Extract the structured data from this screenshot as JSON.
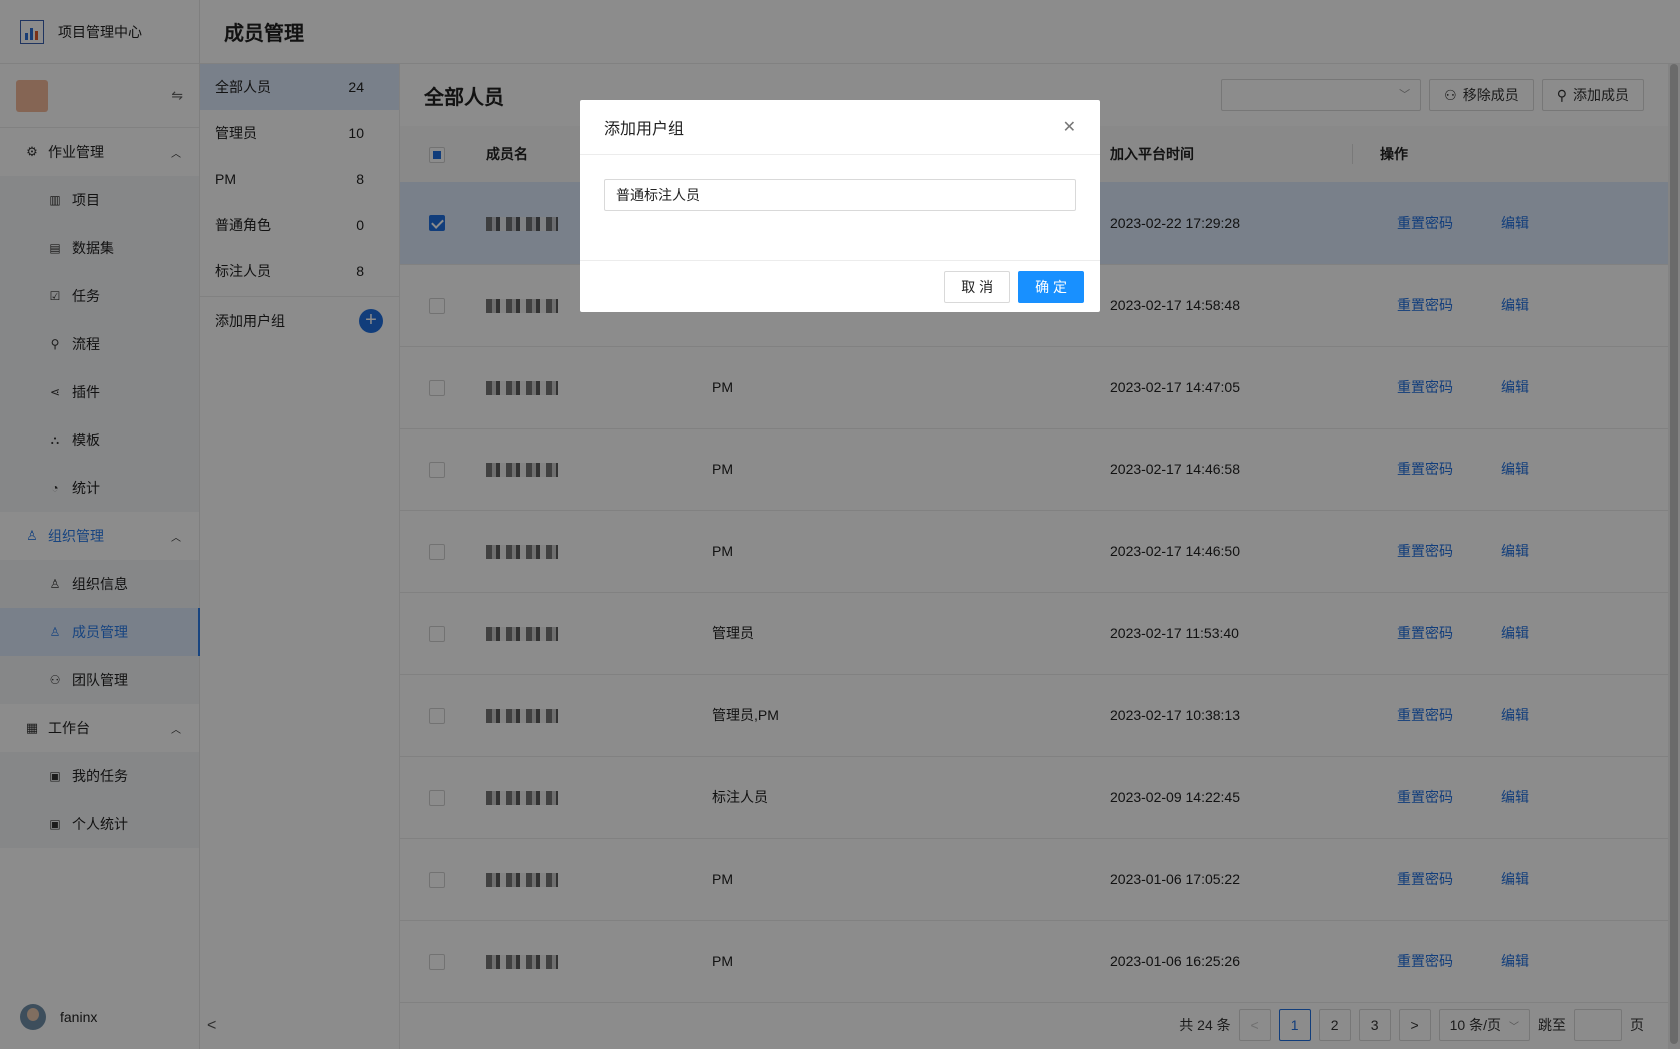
{
  "app": {
    "title": "项目管理中心",
    "page_title": "成员管理"
  },
  "sidebar": {
    "groups": [
      {
        "label": "作业管理",
        "icon": "gear-icon",
        "items": [
          {
            "label": "项目",
            "icon": "project-icon"
          },
          {
            "label": "数据集",
            "icon": "dataset-icon"
          },
          {
            "label": "任务",
            "icon": "task-icon"
          },
          {
            "label": "流程",
            "icon": "flow-icon"
          },
          {
            "label": "插件",
            "icon": "plugin-icon"
          },
          {
            "label": "模板",
            "icon": "template-icon"
          },
          {
            "label": "统计",
            "icon": "pie-chart-icon"
          }
        ]
      },
      {
        "label": "组织管理",
        "icon": "user-icon",
        "items": [
          {
            "label": "组织信息",
            "icon": "user-icon"
          },
          {
            "label": "成员管理",
            "icon": "user-icon"
          },
          {
            "label": "团队管理",
            "icon": "team-icon"
          }
        ]
      },
      {
        "label": "工作台",
        "icon": "grid-icon",
        "items": [
          {
            "label": "我的任务",
            "icon": "calendar-icon"
          },
          {
            "label": "个人统计",
            "icon": "calendar-icon"
          }
        ]
      }
    ],
    "selected": "成员管理",
    "user_name": "faninx"
  },
  "user_groups": {
    "items": [
      {
        "label": "全部人员",
        "count": "24"
      },
      {
        "label": "管理员",
        "count": "10"
      },
      {
        "label": "PM",
        "count": "8"
      },
      {
        "label": "普通角色",
        "count": "0"
      },
      {
        "label": "标注人员",
        "count": "8"
      }
    ],
    "add_label": "添加用户组"
  },
  "main": {
    "title": "全部人员",
    "remove_label": "移除成员",
    "add_label": "添加成员",
    "columns": {
      "name": "成员名",
      "joined": "加入平台时间",
      "actions": "操作"
    },
    "rows": [
      {
        "checked": true,
        "role": "",
        "joined": "2023-02-22 17:29:28"
      },
      {
        "checked": false,
        "role": "",
        "joined": "2023-02-17 14:58:48"
      },
      {
        "checked": false,
        "role": "PM",
        "joined": "2023-02-17 14:47:05"
      },
      {
        "checked": false,
        "role": "PM",
        "joined": "2023-02-17 14:46:58"
      },
      {
        "checked": false,
        "role": "PM",
        "joined": "2023-02-17 14:46:50"
      },
      {
        "checked": false,
        "role": "管理员",
        "joined": "2023-02-17 11:53:40"
      },
      {
        "checked": false,
        "role": "管理员,PM",
        "joined": "2023-02-17 10:38:13"
      },
      {
        "checked": false,
        "role": "标注人员",
        "joined": "2023-02-09 14:22:45"
      },
      {
        "checked": false,
        "role": "PM",
        "joined": "2023-01-06 17:05:22"
      },
      {
        "checked": false,
        "role": "PM",
        "joined": "2023-01-06 16:25:26"
      }
    ],
    "row_actions": {
      "reset": "重置密码",
      "edit": "编辑"
    }
  },
  "pagination": {
    "total": "共 24 条",
    "pages": [
      "1",
      "2",
      "3"
    ],
    "current": "1",
    "page_size": "10 条/页",
    "jump_label": "跳至",
    "page_suffix": "页"
  },
  "modal": {
    "title": "添加用户组",
    "input_value": "普通标注人员",
    "cancel": "取 消",
    "ok": "确 定"
  },
  "colors": {
    "accent": "#1f6fe0",
    "primary_button": "#1890ff",
    "selected_bg": "#dce9fb"
  }
}
